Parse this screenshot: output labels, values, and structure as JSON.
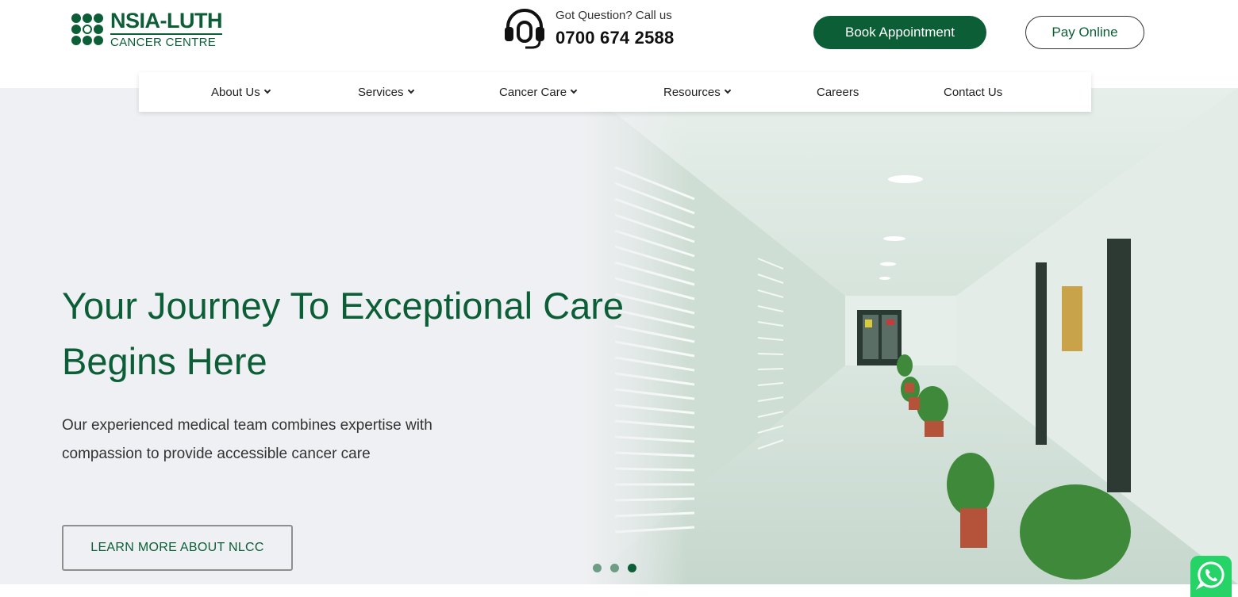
{
  "header": {
    "logo": {
      "main": "NSIA-LUTH",
      "sub": "CANCER CENTRE"
    },
    "call": {
      "question": "Got Question? Call us",
      "number": "0700 674 2588",
      "icon": "headset-icon"
    },
    "book_label": "Book Appointment",
    "pay_label": "Pay Online"
  },
  "nav": {
    "items": [
      {
        "label": "About Us",
        "has_dropdown": true
      },
      {
        "label": "Services",
        "has_dropdown": true
      },
      {
        "label": "Cancer Care",
        "has_dropdown": true
      },
      {
        "label": "Resources",
        "has_dropdown": true
      },
      {
        "label": "Careers",
        "has_dropdown": false
      },
      {
        "label": "Contact Us",
        "has_dropdown": false
      }
    ]
  },
  "hero": {
    "headline_line1": "Your Journey To Exceptional Care",
    "headline_line2": "Begins Here",
    "subtext_line1": "Our experienced medical team combines expertise with",
    "subtext_line2": "compassion to provide accessible cancer care",
    "cta_label": "LEARN MORE ABOUT NLCC",
    "slides": {
      "count": 3,
      "active": 3
    }
  },
  "colors": {
    "brand": "#0c5e36",
    "hero_bg": "#eff0f3",
    "whatsapp": "#25d366"
  },
  "floating": {
    "icon": "whatsapp-icon"
  }
}
